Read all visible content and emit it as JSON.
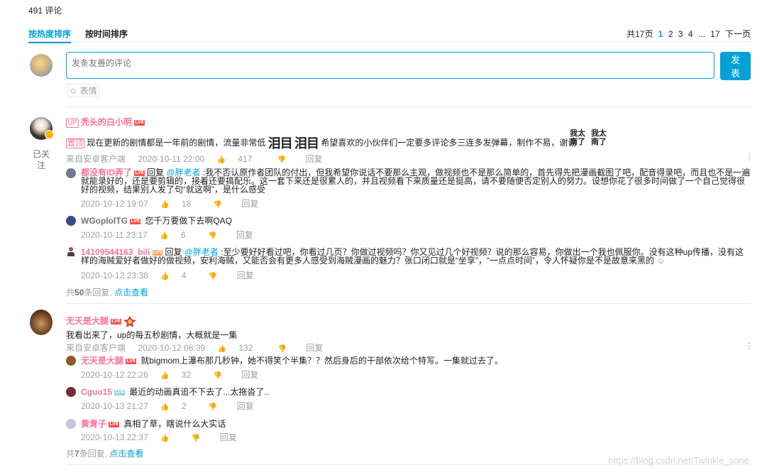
{
  "header": {
    "count": "491",
    "count_label": "评论",
    "tab_hot": "按热度排序",
    "tab_time": "按时间排序",
    "pager": {
      "total": "共17页",
      "pages": [
        "1",
        "2",
        "3",
        "4"
      ],
      "ellipsis": "...",
      "last": "17",
      "next": "下一页"
    }
  },
  "composer": {
    "placeholder": "发条友善的评论",
    "send": "发表",
    "emoji": "表情"
  },
  "comments": [
    {
      "up_label": "UP",
      "user": "秃头的白小明",
      "level": "LV6",
      "follow": "已关注",
      "tag": "置顶",
      "text_a": "现在更新的剧情都是一年前的剧情，流量非常低",
      "text_b": "希望喜欢的小伙伴们一定要多评论多三连多发弹幕，制作不易，谢谢",
      "meta_source": "来自安卓客户端",
      "meta_time": "2020-10-11 22:00",
      "meta_likes": "417",
      "meta_reply": "回复",
      "replies": [
        {
          "user": "都没有ID弄了",
          "level": "LV6",
          "reply_word": "回复",
          "mention": "@胖老者",
          "text": ":我不否认原作者团队的付出，但我希望你说话不要那么主观，做视频也不是那么简单的，首先得先把漫画截图了吧，配音得录吧，而且也不是一遍就能录好的，还是要剪辑的，接着还要搞配乐。这一套下来还是很累人的，并且视频看下来质量还是挺高，请不要随便否定别人的努力。设想你花了很多时间做了一个自己觉得很好的视频，结果别人发了句“就这啊”，是什么感受",
          "time": "2020-10-12 19:07",
          "likes": "18",
          "reply": "回复"
        },
        {
          "user": "WGoplolTG",
          "level": "LV6",
          "text": "您千万要做下去啊QAQ",
          "time": "2020-10-11 23:17",
          "likes": "6",
          "reply": "回复"
        },
        {
          "user": "14109544163_bili",
          "level": "LV5",
          "reply_word": "回复",
          "mention": "@胖老者",
          "text": ":至少要好好看过吧，你看过几页？你做过视频吗？你又见过几个好视频？说的那么容易，你做出一个我也佩服你。没有这种up传播，没有这样的海贼爱好者做好的做视频，安利海贼，又能否会有更多人感受到海贼漫画的魅力？张口闭口就是“坐享”，“一点点时间”，令人怀疑你是不是故意来黑的",
          "time": "2020-10-12 23:38",
          "likes": "4",
          "reply": "回复"
        }
      ],
      "footer_pre": "共",
      "footer_num": "50",
      "footer_post": "条回复,",
      "footer_link": "点击查看"
    },
    {
      "user": "无天是大腿",
      "level": "LV6",
      "text": "我看出来了，up的每五秒剧情，大概就是一集",
      "meta_source": "来自安卓客户端",
      "meta_time": "2020-10-12 08:39",
      "meta_likes": "132",
      "meta_reply": "回复",
      "replies": [
        {
          "user": "无天是大腿",
          "level": "LV6",
          "text": "就bigmom上瀑布那几秒钟，她不得笑个半集？？然后身后的干部依次给个特写。一集就过去了。",
          "time": "2020-10-12 22:26",
          "likes": "32",
          "reply": "回复"
        },
        {
          "user": "Cguo15",
          "level": "LV4",
          "text": "最近的动画真追不下去了...太拖沓了..",
          "time": "2020-10-13 21:27",
          "likes": "2",
          "reply": "回复"
        },
        {
          "user": "黄青子",
          "level": "LV6",
          "text": "真相了草，瞎说什么大实话",
          "time": "2020-10-13 22:37",
          "likes": "",
          "reply": "回复"
        }
      ],
      "footer_pre": "共",
      "footer_num": "7",
      "footer_post": "条回复,",
      "footer_link": "点击查看"
    }
  ],
  "sticker_text": "我太\n南了",
  "watermark": "https://blog.csdn.net/Twinkle_sone"
}
